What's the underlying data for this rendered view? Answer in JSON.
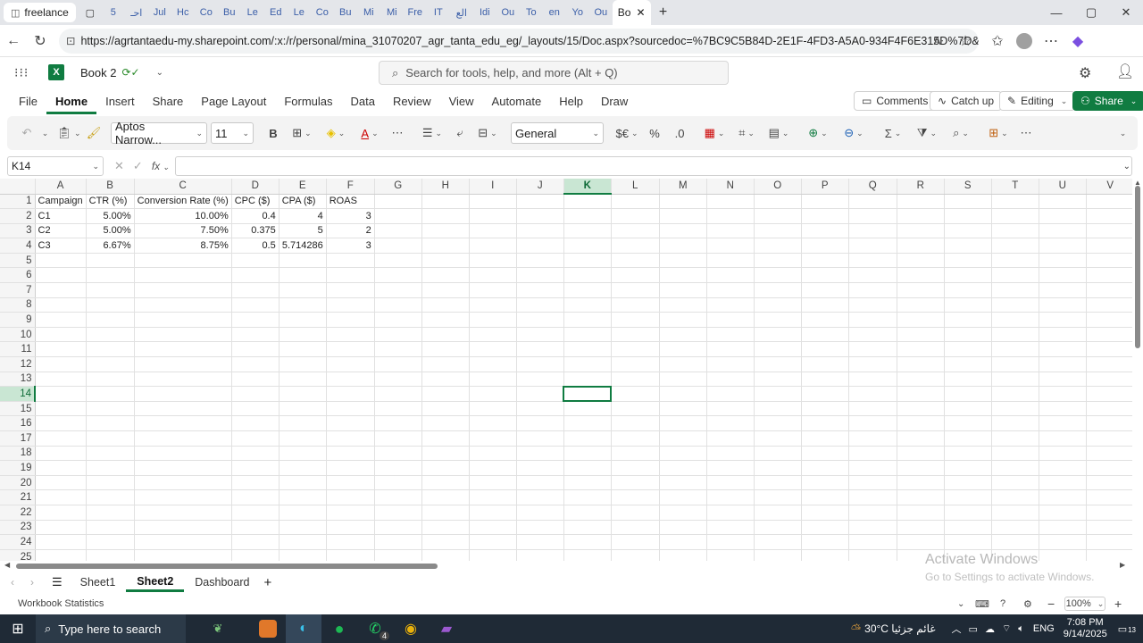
{
  "browser": {
    "pinned_tab": "freelance",
    "active_tab": "Bo",
    "tab_icons": [
      "5",
      "احـ",
      "Jul",
      "Hc",
      "Co",
      "Bu",
      "Le",
      "Ed",
      "Le",
      "Co",
      "Bu",
      "Mi",
      "Mi",
      "Fre",
      "IT",
      "الع",
      "Idi",
      "Ou",
      "To",
      "en",
      "Yo",
      "Ou"
    ],
    "url": "https://agrtantaedu-my.sharepoint.com/:x:/r/personal/mina_31070207_agr_tanta_edu_eg/_layouts/15/Doc.aspx?sourcedoc=%7BC9C5B84D-2E1F-4FD3-A5A0-934F4F6E315D%7D&file=Book%2..."
  },
  "excel": {
    "doc_title": "Book 2",
    "search_placeholder": "Search for tools, help, and more (Alt + Q)",
    "menus": [
      "File",
      "Home",
      "Insert",
      "Share",
      "Page Layout",
      "Formulas",
      "Data",
      "Review",
      "View",
      "Automate",
      "Help",
      "Draw"
    ],
    "active_menu": "Home",
    "comments_label": "Comments",
    "catchup_label": "Catch up",
    "editing_label": "Editing",
    "share_label": "Share",
    "font_name": "Aptos Narrow...",
    "font_size": "11",
    "number_format": "General",
    "name_box": "K14",
    "fx_label": "fx"
  },
  "sheet": {
    "columns": [
      "A",
      "B",
      "C",
      "D",
      "E",
      "F",
      "G",
      "H",
      "I",
      "J",
      "K",
      "L",
      "M",
      "N",
      "O",
      "P",
      "Q",
      "R",
      "S",
      "T",
      "U",
      "V"
    ],
    "selected_col": "K",
    "selected_row": 14,
    "row_count": 25,
    "rows": [
      [
        "Campaign",
        "CTR (%)",
        "Conversion Rate (%)",
        "CPC ($)",
        "CPA ($)",
        "ROAS"
      ],
      [
        "C1",
        "5.00%",
        "10.00%",
        "0.4",
        "4",
        "3"
      ],
      [
        "C2",
        "5.00%",
        "7.50%",
        "0.375",
        "5",
        "2"
      ],
      [
        "C3",
        "6.67%",
        "8.75%",
        "0.5",
        "5.714286",
        "3"
      ]
    ]
  },
  "sheet_tabs": [
    "Sheet1",
    "Sheet2",
    "Dashboard"
  ],
  "active_sheet": "Sheet2",
  "status": {
    "left": "Workbook Statistics",
    "zoom": "100%"
  },
  "watermark": {
    "line1": "Activate Windows",
    "line2": "Go to Settings to activate Windows."
  },
  "taskbar": {
    "search_placeholder": "Type here to search",
    "weather": "30°C غائم جزئيا",
    "lang": "ENG",
    "time": "7:08 PM",
    "date": "9/14/2025",
    "whatsapp_badge": "4",
    "notif_badge": "13"
  }
}
